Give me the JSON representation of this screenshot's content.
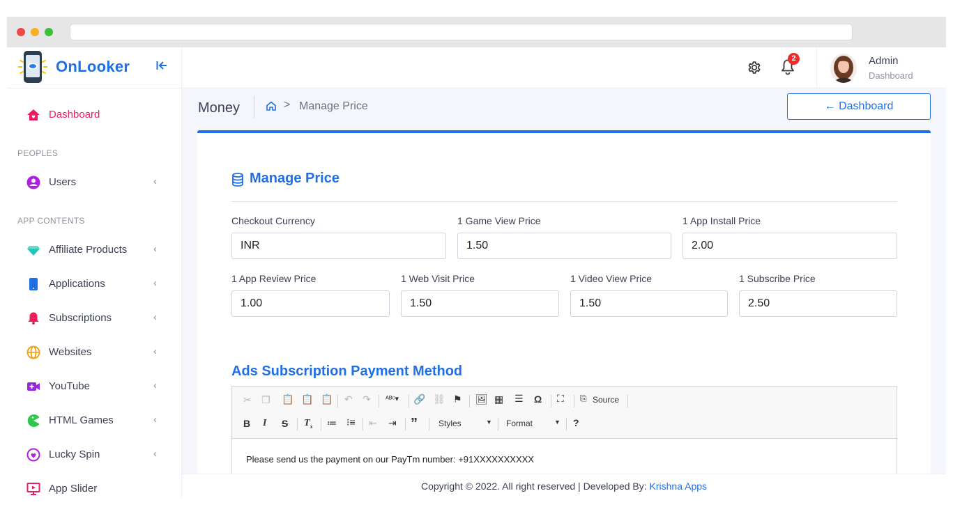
{
  "brand": {
    "name": "OnLooker"
  },
  "sidebar": {
    "dashboard": "Dashboard",
    "sections": {
      "peoples": "PEOPLES",
      "app_contents": "APP CONTENTS"
    },
    "items": [
      {
        "label": "Users"
      },
      {
        "label": "Affiliate Products"
      },
      {
        "label": "Applications"
      },
      {
        "label": "Subscriptions"
      },
      {
        "label": "Websites"
      },
      {
        "label": "YouTube"
      },
      {
        "label": "HTML Games"
      },
      {
        "label": "Lucky Spin"
      },
      {
        "label": "App Slider"
      }
    ]
  },
  "header": {
    "notification_count": "2",
    "user_name": "Admin",
    "user_role": "Dashboard"
  },
  "page": {
    "title": "Money",
    "breadcrumb_current": "Manage Price",
    "back_button": "← Dashboard"
  },
  "form": {
    "title": "Manage Price",
    "fields": [
      {
        "label": "Checkout Currency",
        "value": "INR"
      },
      {
        "label": "1 Game View Price",
        "value": "1.50"
      },
      {
        "label": "1 App Install Price",
        "value": "2.00"
      },
      {
        "label": "1 App Review Price",
        "value": "1.00"
      },
      {
        "label": "1 Web Visit Price",
        "value": "1.50"
      },
      {
        "label": "1 Video View Price",
        "value": "1.50"
      },
      {
        "label": "1 Subscribe Price",
        "value": "2.50"
      }
    ]
  },
  "ads": {
    "title": "Ads Subscription Payment Method",
    "toolbar": {
      "source": "Source",
      "styles": "Styles",
      "format": "Format"
    },
    "content": "Please send us the payment on our PayTm number: +91XXXXXXXXXX"
  },
  "footer": {
    "text": "Copyright © 2022. All right reserved | Developed By:",
    "link": "Krishna Apps"
  },
  "colors": {
    "primary": "#1f6fe5",
    "dashboard_active": "#e91e63",
    "badge": "#ec2b2b"
  }
}
